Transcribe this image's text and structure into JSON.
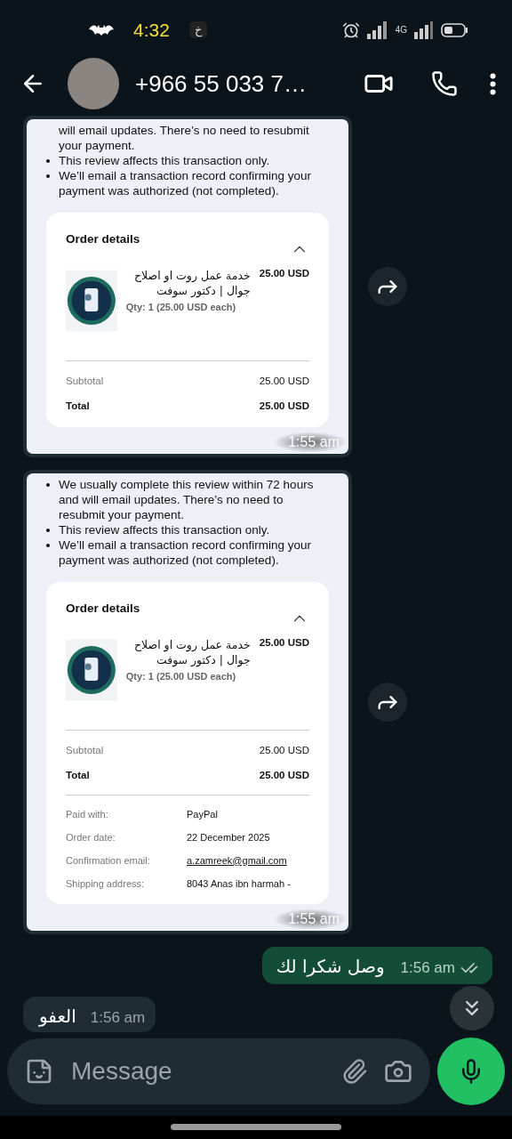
{
  "status_bar": {
    "time": "4:32",
    "notification_glyph": "خ",
    "network": "4G"
  },
  "header": {
    "contact": "+966 55 033 7…"
  },
  "messages": [
    {
      "kind": "image",
      "time": "1:55 am",
      "document": {
        "bullets": [
          {
            "kind": "continuation",
            "text": "will email updates. There’s no need to resubmit your payment."
          },
          {
            "kind": "bullet",
            "text": "This review affects this transaction only."
          },
          {
            "kind": "bullet",
            "text": "We’ll email a transaction record confirming your payment was authorized (not completed)."
          }
        ],
        "order": {
          "title": "Order details",
          "expanded": true,
          "item": {
            "name": "خدمة عمل روت او اصلاح جوال | دكتور سوفت",
            "price": "25.00 USD",
            "qty": "Qty: 1 (25.00 USD each)"
          },
          "totals": [
            {
              "kind": "normal",
              "label": "Subtotal",
              "value": "25.00 USD"
            },
            {
              "kind": "bold",
              "label": "Total",
              "value": "25.00 USD"
            }
          ]
        }
      }
    },
    {
      "kind": "image",
      "time": "1:55 am",
      "document": {
        "bullets": [
          {
            "kind": "bullet",
            "text": "We usually complete this review within 72 hours and will email updates. There’s no need to resubmit your payment."
          },
          {
            "kind": "bullet",
            "text": "This review affects this transaction only."
          },
          {
            "kind": "bullet",
            "text": "We’ll email a transaction record confirming your payment was authorized (not completed)."
          }
        ],
        "order": {
          "title": "Order details",
          "expanded": true,
          "item": {
            "name": "خدمة عمل روت او اصلاح جوال | دكتور سوفت",
            "price": "25.00 USD",
            "qty": "Qty: 1 (25.00 USD each)"
          },
          "totals": [
            {
              "kind": "normal",
              "label": "Subtotal",
              "value": "25.00 USD"
            },
            {
              "kind": "bold",
              "label": "Total",
              "value": "25.00 USD"
            }
          ],
          "details": [
            {
              "kind": "text",
              "label": "Paid with:",
              "value": "PayPal"
            },
            {
              "kind": "text",
              "label": "Order date:",
              "value": "22 December 2025"
            },
            {
              "kind": "link",
              "label": "Confirmation email:",
              "value": "a.zamreek@gmail.com"
            },
            {
              "kind": "text",
              "label": "Shipping address:",
              "value": "8043 Anas ibn harmah -"
            }
          ]
        }
      }
    },
    {
      "kind": "text",
      "outgoing": true,
      "text": "وصل شكرا لك",
      "time": "1:56 am",
      "read": false
    },
    {
      "kind": "text",
      "outgoing": false,
      "text": "العفو",
      "time": "1:56 am"
    }
  ],
  "composer": {
    "placeholder": "Message"
  }
}
